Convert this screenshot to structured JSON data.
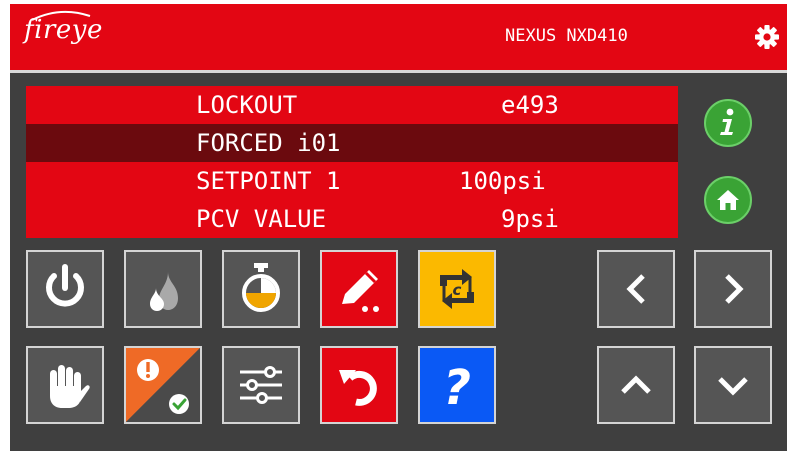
{
  "header": {
    "brand": "fireye",
    "model": "NEXUS NXD410",
    "settings_icon": "gear-icon"
  },
  "colors": {
    "brand_red": "#e30613",
    "selected_row": "#6b0a0e",
    "info_green": "#3aa335",
    "yellow": "#fbb900",
    "blue": "#0a59f5",
    "orange": "#ef6a26",
    "panel": "#3f3f3f"
  },
  "display": {
    "rows": [
      {
        "label": "LOCKOUT",
        "value": "e493"
      },
      {
        "label": "FORCED i01",
        "value": ""
      },
      {
        "label": "SETPOINT 1",
        "value": "100psi"
      },
      {
        "label": "PCV VALUE",
        "value": "9psi"
      }
    ],
    "selected_row": 2
  },
  "side_buttons": {
    "info_icon": "info-icon",
    "home_icon": "home-icon"
  },
  "buttons": {
    "row1": [
      "power-icon",
      "flame-icon",
      "timer-icon",
      "edit-icon",
      "cycle-icon"
    ],
    "row2": [
      "hand-icon",
      "alarm-reset-icon",
      "sliders-icon",
      "undo-icon",
      "help-icon"
    ],
    "nav": [
      "chevron-left-icon",
      "chevron-right-icon",
      "chevron-up-icon",
      "chevron-down-icon"
    ],
    "cycle_letter": "c",
    "help_glyph": "?"
  }
}
